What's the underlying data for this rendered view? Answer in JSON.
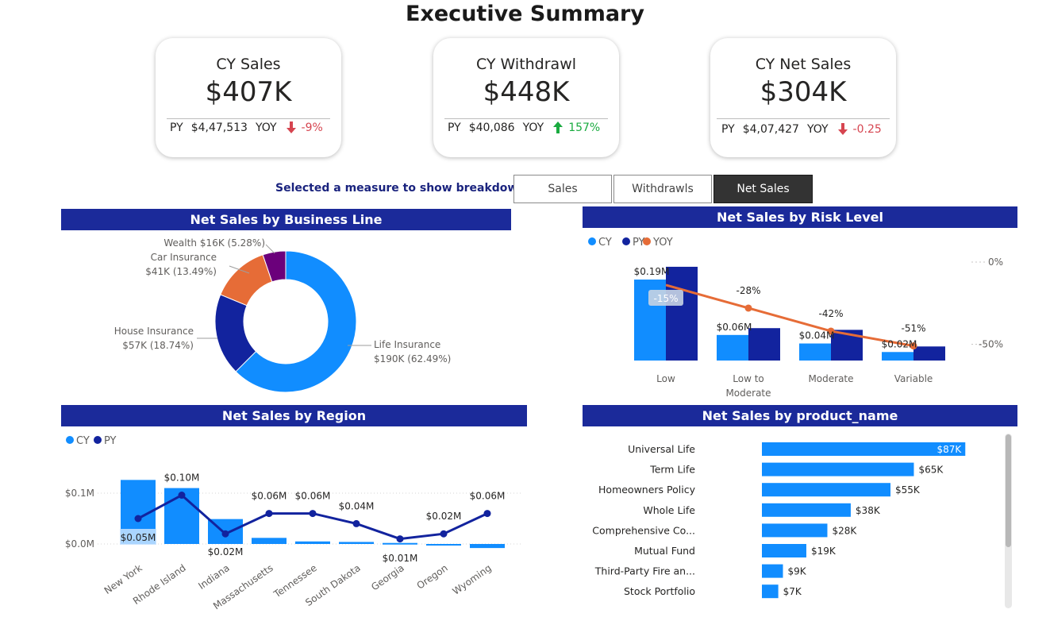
{
  "page": {
    "title": "Executive Summary"
  },
  "kpis": [
    {
      "title": "CY Sales",
      "value": "$407K",
      "py_label": "PY",
      "py_value": "$4,47,513",
      "yoy_label": "YOY",
      "direction": "down",
      "yoy": "-9%"
    },
    {
      "title": "CY Withdrawl",
      "value": "$448K",
      "py_label": "PY",
      "py_value": "$40,086",
      "yoy_label": "YOY",
      "direction": "up",
      "yoy": "157%"
    },
    {
      "title": "CY Net Sales",
      "value": "$304K",
      "py_label": "PY",
      "py_value": "$4,07,427",
      "yoy_label": "YOY",
      "direction": "down",
      "yoy": "-0.25"
    }
  ],
  "measure_selector": {
    "label": "Selected a measure to show breakdown",
    "buttons": [
      "Sales",
      "Withdrawls",
      "Net Sales"
    ],
    "selected": "Net Sales"
  },
  "colors": {
    "header": "#1b2a9a",
    "cy": "#118dff",
    "py": "#12239e",
    "yoy": "#e66c37",
    "down": "#d64550",
    "up": "#1aab40"
  },
  "chart_data": [
    {
      "type": "pie",
      "title": "Net Sales by Business Line",
      "donut": true,
      "slices": [
        {
          "label": "Life Insurance",
          "value": 190,
          "value_label": "$190K (62.49%)",
          "percent": 62.49,
          "color": "#118dff"
        },
        {
          "label": "House Insurance",
          "value": 57,
          "value_label": "$57K (18.74%)",
          "percent": 18.74,
          "color": "#12239e"
        },
        {
          "label": "Car Insurance",
          "value": 41,
          "value_label": "$41K (13.49%)",
          "percent": 13.49,
          "color": "#e66c37"
        },
        {
          "label": "Wealth",
          "value": 16,
          "value_label": "$16K (5.28%)",
          "percent": 5.28,
          "color": "#6b007b"
        }
      ]
    },
    {
      "type": "bar",
      "title": "Net Sales by Risk Level",
      "legend": [
        "CY",
        "PY",
        "YOY"
      ],
      "legend_position": "top-left",
      "categories": [
        "Low",
        "Low to Moderate",
        "Moderate",
        "Variable"
      ],
      "series": [
        {
          "name": "CY",
          "values": [
            0.19,
            0.06,
            0.04,
            0.02
          ]
        },
        {
          "name": "PY",
          "values": [
            0.22,
            0.076,
            0.072,
            0.033
          ]
        }
      ],
      "line_series": {
        "name": "YOY",
        "values": [
          -14,
          -28,
          -42,
          -51
        ]
      },
      "data_labels": {
        "cy": [
          "$0.19M",
          "$0.06M",
          "$0.04M",
          "$0.02M"
        ],
        "yoy": [
          "-15%",
          "-28%",
          "-42%",
          "-51%"
        ]
      },
      "secondary_axis_ticks": [
        "0%",
        "-50%"
      ],
      "ylim": [
        0,
        0.26
      ],
      "y2lim": [
        -75,
        2
      ]
    },
    {
      "type": "bar",
      "title": "Net Sales by Region",
      "legend": [
        "CY",
        "PY"
      ],
      "legend_position": "top-left",
      "categories": [
        "New York",
        "Rhode Island",
        "Indiana",
        "Massachusetts",
        "Tennessee",
        "South Dakota",
        "Georgia",
        "Oregon",
        "Wyoming"
      ],
      "series": [
        {
          "name": "CY",
          "values": [
            0.126,
            0.11,
            0.049,
            0.012,
            0.005,
            0.004,
            0.002,
            0.0,
            -0.008
          ]
        },
        {
          "name": "PY",
          "values": [
            0.05,
            0.096,
            0.02,
            0.06,
            0.06,
            0.04,
            0.01,
            0.02,
            0.06
          ]
        }
      ],
      "data_labels": [
        "$0.05M",
        "$0.10M",
        "$0.02M",
        "$0.06M",
        "$0.06M",
        "$0.04M",
        "$0.01M",
        "$0.02M",
        "$0.06M"
      ],
      "y_ticks": [
        "$0.1M",
        "$0.0M"
      ],
      "ylim": [
        -0.02,
        0.13
      ]
    },
    {
      "type": "bar",
      "orientation": "horizontal",
      "title": "Net Sales by product_name",
      "categories": [
        "Universal Life",
        "Term Life",
        "Homeowners Policy",
        "Whole Life",
        "Comprehensive Co...",
        "Mutual Fund",
        "Third-Party Fire an...",
        "Stock Portfolio"
      ],
      "values": [
        87,
        65,
        55,
        38,
        28,
        19,
        9,
        7
      ],
      "data_labels": [
        "$87K",
        "$65K",
        "$55K",
        "$38K",
        "$28K",
        "$19K",
        "$9K",
        "$7K"
      ],
      "xlim": [
        0,
        90
      ]
    }
  ]
}
